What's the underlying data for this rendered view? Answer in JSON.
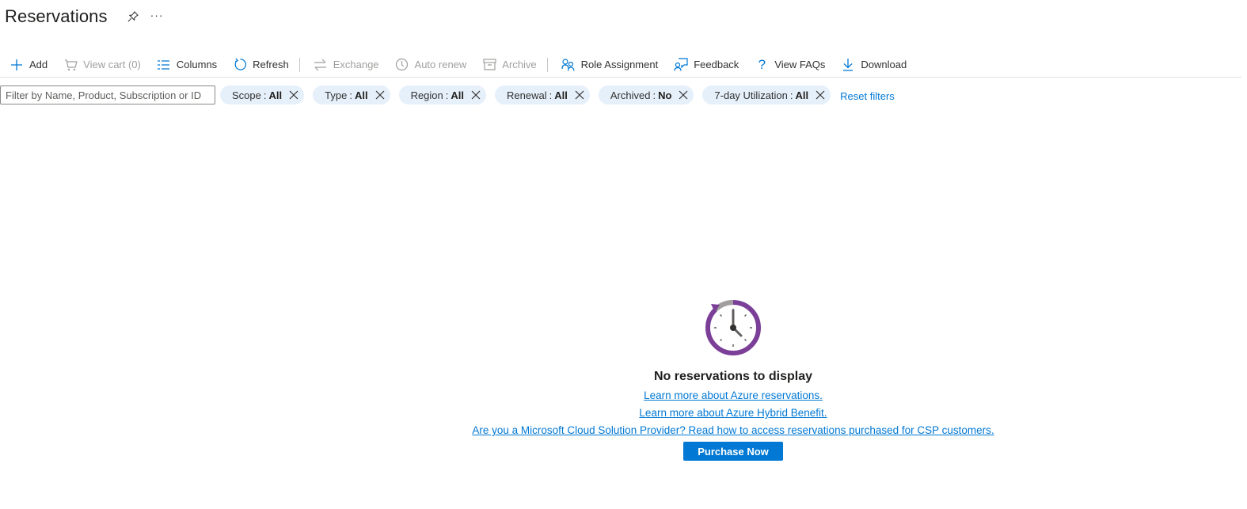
{
  "page": {
    "title": "Reservations",
    "more_label": "···"
  },
  "toolbar": {
    "add": "Add",
    "view_cart": "View cart (0)",
    "columns": "Columns",
    "refresh": "Refresh",
    "exchange": "Exchange",
    "auto_renew": "Auto renew",
    "archive": "Archive",
    "role_assignment": "Role Assignment",
    "feedback": "Feedback",
    "view_faqs": "View FAQs",
    "download": "Download"
  },
  "filters": {
    "search_placeholder": "Filter by Name, Product, Subscription or ID",
    "pills": [
      {
        "label": "Scope",
        "value": "All"
      },
      {
        "label": "Type",
        "value": "All"
      },
      {
        "label": "Region",
        "value": "All"
      },
      {
        "label": "Renewal",
        "value": "All"
      },
      {
        "label": "Archived",
        "value": "No"
      },
      {
        "label": "7-day Utilization",
        "value": "All"
      }
    ],
    "separator": ":",
    "reset": "Reset filters"
  },
  "empty_state": {
    "title": "No reservations to display",
    "link_1": "Learn more about Azure reservations.",
    "link_2": "Learn more about Azure Hybrid Benefit.",
    "link_3": "Are you a Microsoft Cloud Solution Provider? Read how to access reservations purchased for CSP customers.",
    "button": "Purchase Now"
  },
  "colors": {
    "accent": "#0078d4",
    "pill_bg": "#e6f0fa",
    "clock_ring": "#7b3f98",
    "disabled": "#a19f9d"
  }
}
